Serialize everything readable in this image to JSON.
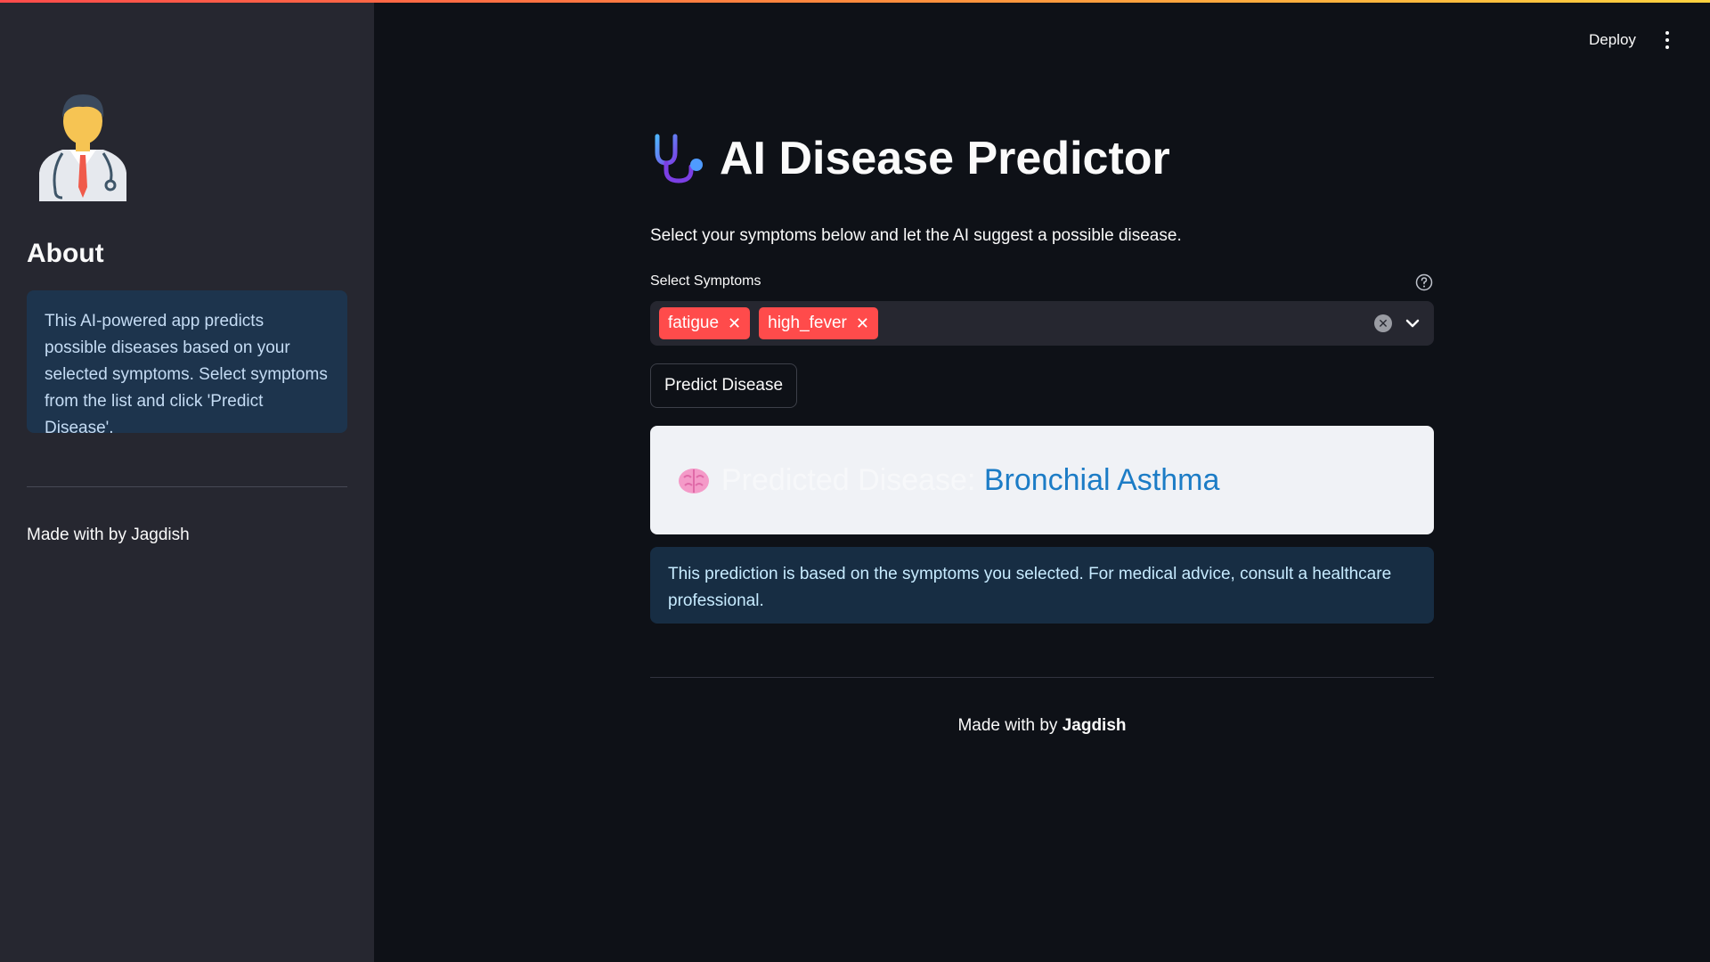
{
  "sidebar": {
    "avatar_icon": "doctor-avatar-icon",
    "about_heading": "About",
    "about_text": "This AI-powered app predicts possible diseases based on your selected symptoms. Select symptoms from the list and click 'Predict Disease'.",
    "footer": "Made with by Jagdish"
  },
  "header": {
    "deploy_label": "Deploy",
    "menu_icon": "kebab-menu-icon"
  },
  "main": {
    "title_icon": "stethoscope-icon",
    "title": "AI Disease Predictor",
    "subtitle": "Select your symptoms below and let the AI suggest a possible disease.",
    "symptoms_label": "Select Symptoms",
    "selected_symptoms": [
      "fatigue",
      "high_fever"
    ],
    "predict_button": "Predict Disease",
    "result_icon": "brain-icon",
    "result_label": "Predicted Disease:",
    "result_value": "Bronchial Asthma",
    "info_text": "This prediction is based on the symptoms you selected. For medical advice, consult a healthcare professional.",
    "footer_prefix": "Made with by",
    "footer_name": "Jagdish"
  },
  "colors": {
    "accent": "#ff4b4b",
    "background": "#0e1117",
    "sidebar": "#262730",
    "result_value": "#1c7cc6"
  }
}
